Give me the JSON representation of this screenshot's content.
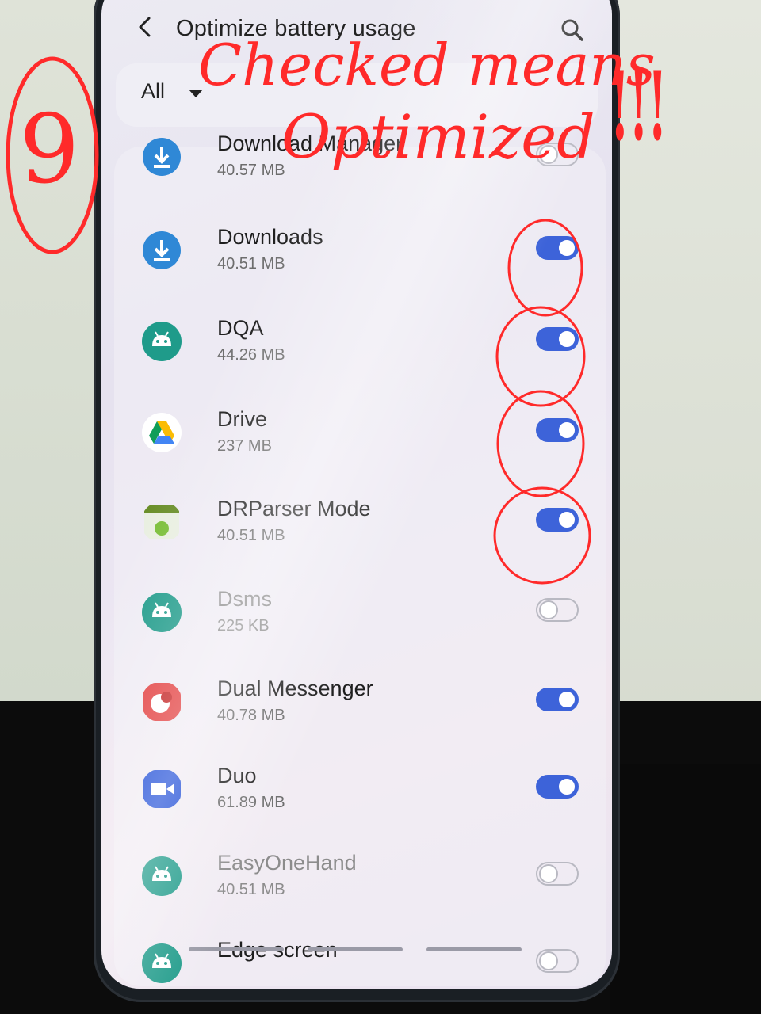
{
  "header": {
    "title": "Optimize battery usage",
    "back_icon": "back-arrow-icon",
    "search_icon": "search-icon"
  },
  "filter": {
    "label": "All",
    "icon": "caret-down-icon"
  },
  "apps": [
    {
      "name": "Download Manager",
      "size": "40.57 MB",
      "optimized": false,
      "icon": "download-icon",
      "partial": true
    },
    {
      "name": "Downloads",
      "size": "40.51 MB",
      "optimized": true,
      "icon": "download-icon"
    },
    {
      "name": "DQA",
      "size": "44.26 MB",
      "optimized": true,
      "icon": "android-icon"
    },
    {
      "name": "Drive",
      "size": "237 MB",
      "optimized": true,
      "icon": "google-drive-icon"
    },
    {
      "name": "DRParser Mode",
      "size": "40.51 MB",
      "optimized": true,
      "icon": "android-app-icon"
    },
    {
      "name": "Dsms",
      "size": "225 KB",
      "optimized": false,
      "icon": "android-icon",
      "dim": true
    },
    {
      "name": "Dual Messenger",
      "size": "40.78 MB",
      "optimized": true,
      "icon": "dual-messenger-icon"
    },
    {
      "name": "Duo",
      "size": "61.89 MB",
      "optimized": true,
      "icon": "video-camera-icon"
    },
    {
      "name": "EasyOneHand",
      "size": "40.51 MB",
      "optimized": false,
      "icon": "android-icon",
      "dim": true
    },
    {
      "name": "Edge screen",
      "size": "",
      "optimized": false,
      "icon": "android-icon",
      "partial": true
    }
  ],
  "annotations": {
    "step_number": "9",
    "note_line1": "Checked means",
    "note_line2": "Optimized",
    "exclaim": "!!!"
  },
  "colors": {
    "toggle_on": "#3d63d9",
    "toggle_off": "#b9b9c2",
    "annotation": "#ff2a2a"
  }
}
